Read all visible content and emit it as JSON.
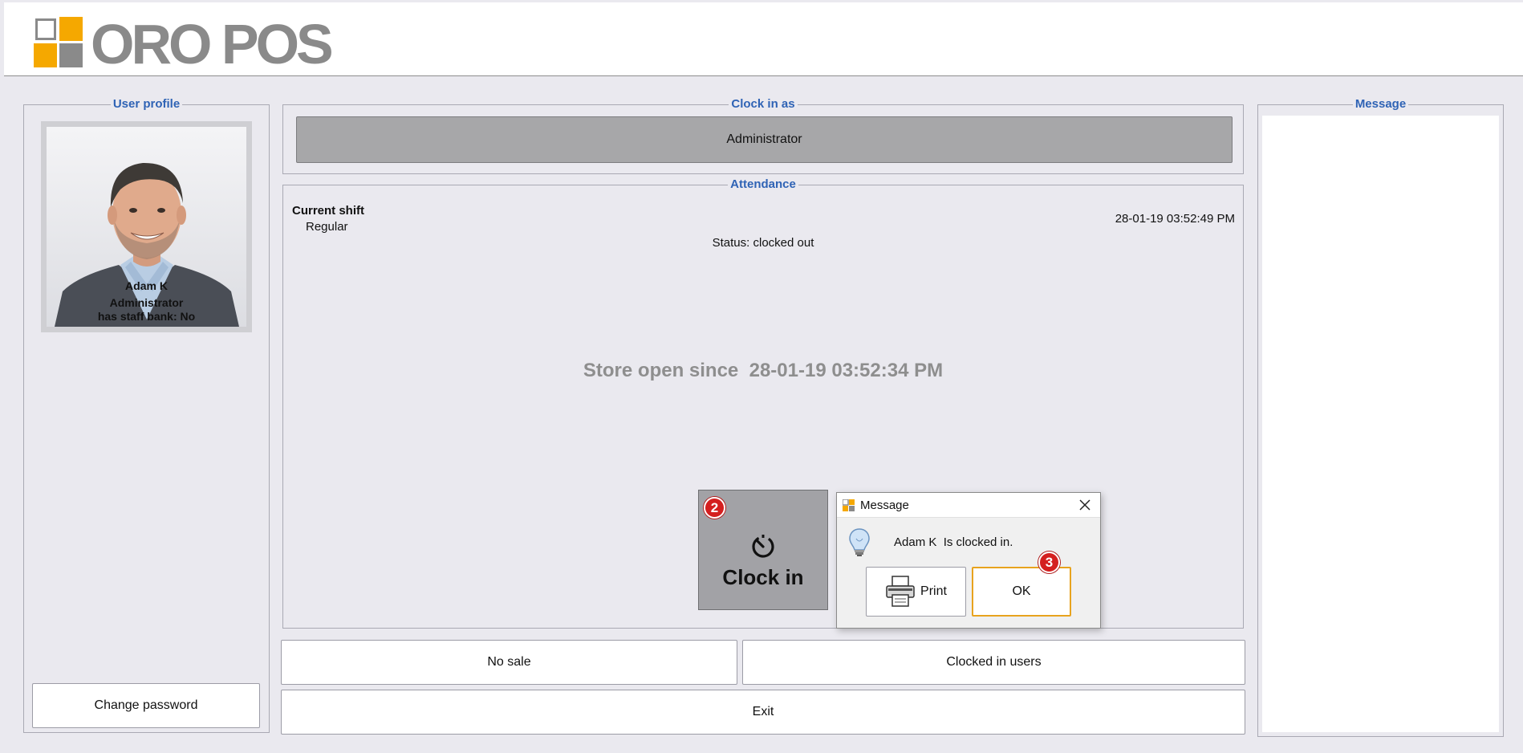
{
  "app": {
    "logo_text": "ORO POS"
  },
  "user_profile": {
    "title": "User profile",
    "name": "Adam K",
    "role": "Administrator",
    "staff_bank": "has staff bank: No",
    "change_password_label": "Change password"
  },
  "clock_in_as": {
    "title": "Clock in as",
    "selected_user": "Administrator"
  },
  "attendance": {
    "title": "Attendance",
    "current_shift_label": "Current shift",
    "shift_name": "Regular",
    "timestamp": "28-01-19 03:52:49 PM",
    "status": "Status: clocked out",
    "store_open_text": "Store open since  28-01-19 03:52:34 PM",
    "clock_in_label": "Clock in"
  },
  "buttons": {
    "no_sale": "No sale",
    "clocked_in_users": "Clocked in users",
    "exit": "Exit"
  },
  "message_panel": {
    "title": "Message"
  },
  "dialog": {
    "title": "Message",
    "text": "Adam K  Is clocked in.",
    "print_label": "Print",
    "ok_label": "OK"
  },
  "steps": {
    "clock_in_step": "2",
    "ok_step": "3"
  },
  "colors": {
    "accent": "#2f63b5",
    "logo_orange": "#f5a800",
    "logo_gray": "#8a8a8a",
    "badge_red": "#d41f1f",
    "ok_border": "#e8a31e"
  },
  "icons": [
    "timer-icon",
    "lightbulb-icon",
    "printer-icon",
    "close-icon",
    "app-icon"
  ]
}
